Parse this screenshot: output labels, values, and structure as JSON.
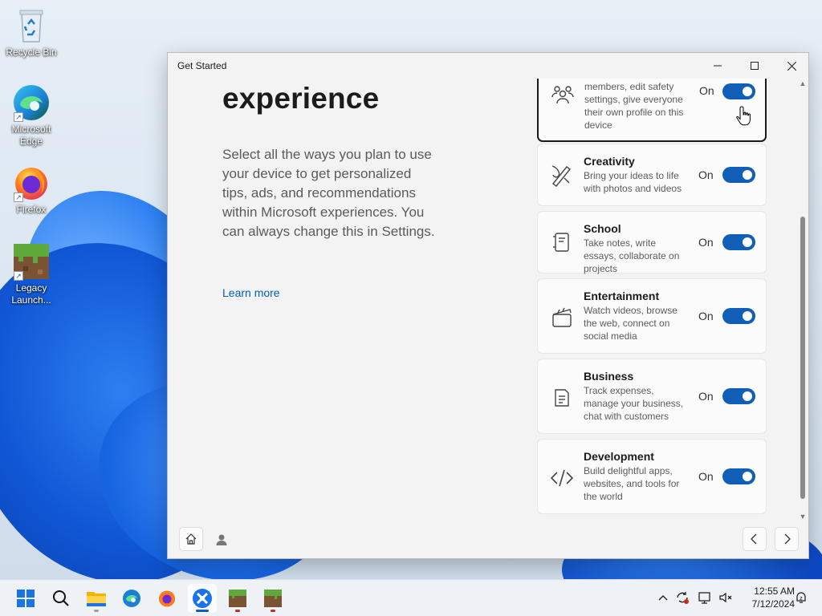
{
  "desktop": {
    "icons": [
      {
        "label": "Recycle Bin",
        "icon": "recycle-bin-icon"
      },
      {
        "label": "Microsoft Edge",
        "icon": "edge-icon"
      },
      {
        "label": "Firefox",
        "icon": "firefox-icon"
      },
      {
        "label": "Legacy Launch...",
        "icon": "minecraft-icon"
      }
    ]
  },
  "window": {
    "title": "Get Started",
    "heading": "experience",
    "description": "Select all the ways you plan to use your device to get personalized tips, ads, and recommendations within Microsoft experiences. You can always change this in Settings.",
    "learn_more": "Learn more",
    "toggle_state_label": "On",
    "accent_color": "#0f5fb6",
    "cards": [
      {
        "title": "",
        "description": "members, edit safety settings, give everyone their own profile on this device",
        "icon": "family-icon",
        "toggle": true
      },
      {
        "title": "Creativity",
        "description": "Bring your ideas to life with photos and videos",
        "icon": "creativity-icon",
        "toggle": true
      },
      {
        "title": "School",
        "description": "Take notes, write essays, collaborate on projects",
        "icon": "notebook-icon",
        "toggle": true
      },
      {
        "title": "Entertainment",
        "description": "Watch videos, browse the web, connect on social media",
        "icon": "clapperboard-icon",
        "toggle": true
      },
      {
        "title": "Business",
        "description": "Track expenses, manage your business, chat with customers",
        "icon": "document-icon",
        "toggle": true
      },
      {
        "title": "Development",
        "description": "Build delightful apps, websites, and tools for the world",
        "icon": "code-icon",
        "toggle": true
      }
    ]
  },
  "taskbar": {
    "apps": [
      "start-icon",
      "search-icon",
      "file-explorer-icon",
      "edge-icon",
      "firefox-icon",
      "get-started-icon",
      "minecraft-icon",
      "minecraft-icon"
    ],
    "clock": {
      "time": "12:55 AM",
      "date": "7/12/2024"
    }
  }
}
